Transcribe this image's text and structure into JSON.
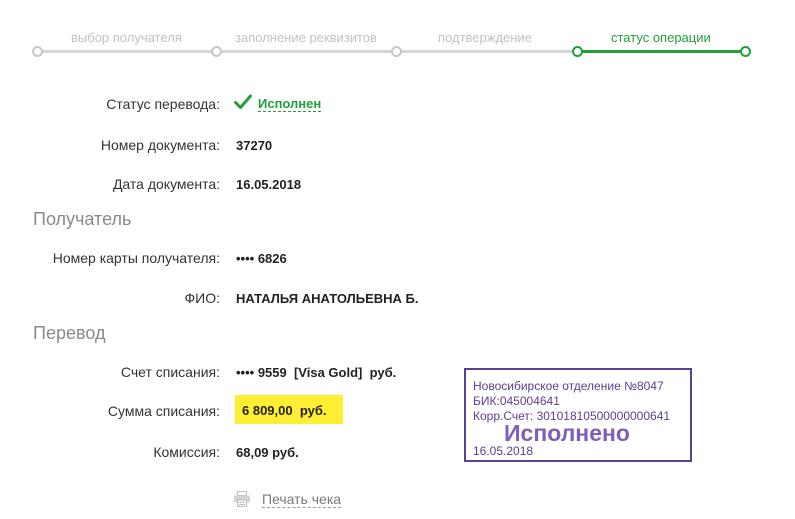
{
  "stepper": {
    "steps": [
      {
        "label": "выбор получателя",
        "state": "done"
      },
      {
        "label": "заполнение реквизитов",
        "state": "done"
      },
      {
        "label": "подтверждение",
        "state": "done"
      },
      {
        "label": "статус операции",
        "state": "active"
      }
    ],
    "colors": {
      "active": "#21a038",
      "inactive": "#c2c2c2"
    }
  },
  "status": {
    "label": "Статус перевода:",
    "value": "Исполнен",
    "icon": "checkmark-icon",
    "color": "#21a038"
  },
  "document": {
    "number_label": "Номер документа:",
    "number_value": "37270",
    "date_label": "Дата документа:",
    "date_value": "16.05.2018"
  },
  "recipient": {
    "section_title": "Получатель",
    "card_label": "Номер карты получателя:",
    "card_value": "•••• 6826",
    "name_label": "ФИО:",
    "name_value": "НАТАЛЬЯ АНАТОЛЬЕВНА Б."
  },
  "transfer": {
    "section_title": "Перевод",
    "account_label": "Счет списания:",
    "account_value": "•••• 9559  [Visa Gold]  руб.",
    "amount_label": "Сумма списания:",
    "amount_value": "6 809,00  руб.",
    "amount_highlight_color": "#ffee33",
    "fee_label": "Комиссия:",
    "fee_value": "68,09 руб."
  },
  "stamp": {
    "line1": "Новосибирское отделение №8047",
    "line2": "БИК:045004641",
    "line3": "Корр.Счет: 30101810500000000641",
    "big_text": "Исполнено",
    "date": "16.05.2018",
    "color": "#5b3f93"
  },
  "print": {
    "label": "Печать чека",
    "icon": "printer-icon"
  }
}
